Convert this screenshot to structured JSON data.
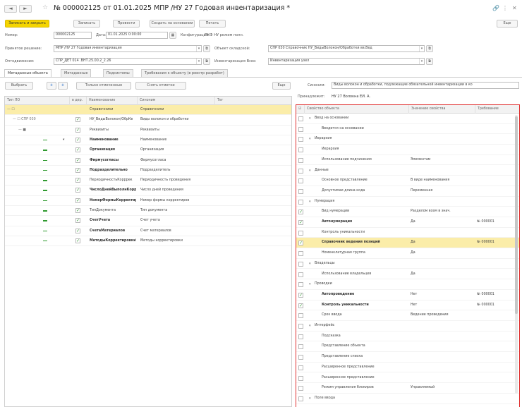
{
  "window": {
    "title": "№ 000002125 от 01.01.2025 МПР /НУ 27 Годовая инвентаризация *",
    "nav_back": "◄",
    "nav_fwd": "►",
    "more_label": "Еще"
  },
  "toolbar": {
    "post_close": "Записать и закрыть",
    "write": "Записать",
    "post": "Провести",
    "create_based": "Создать на основании",
    "print": "Печать"
  },
  "header": {
    "number_label": "Номер:",
    "number_value": "000002125",
    "date_label": "Дата:",
    "date_value": "01.01.2025 0:00:00",
    "config_label": "Конфигурация:",
    "config_value": "ПКФ НУ режим полн.",
    "basis_label": "Принятое решение:",
    "basis_value": "МПР /НУ 27 Годовая инвентаризация",
    "object_label": "Объект складской:",
    "object_value": "СПР 030 Справочник НУ_ВидыВолокон/Обработки вв.Вед",
    "org_label": "Оптодвижения:",
    "org_value": "СПР_ДЕТ 014 .ВНТ.25.00.2_2.26",
    "journal_label": "Инвентаризация Всех:",
    "journal_value": "Инвентаризация узел"
  },
  "tabs": [
    "Метаданные объекта",
    "Метаданные",
    "Подсистемы",
    "Требования к объекту (в реестр разработ)"
  ],
  "left": {
    "select_btn": "Выбрать",
    "add_btn": "+",
    "add2_btn": "+",
    "selected_btn": "Только отмеченные",
    "all_btn": "Снять отметки",
    "columns": [
      "Тип ЛО",
      "в дер.",
      "Наименование",
      "Синоним",
      "Тег"
    ],
    "rows": [
      {
        "tree": "— ☐",
        "mark": "",
        "name": "Справочники",
        "syn": "Справочники",
        "bold": false,
        "sel": true,
        "indent": 0
      },
      {
        "tree": "— ☐ СПР 030",
        "mark": "✓",
        "name": "НУ_ВидыВолокон/ОбрКв",
        "syn": "Виды волокон и обработки",
        "bold": false,
        "sel": false,
        "indent": 1
      },
      {
        "tree": "— ■",
        "mark": "✓",
        "name": "Реквизиты",
        "syn": "Реквизиты",
        "bold": false,
        "sel": false,
        "indent": 2
      },
      {
        "tree": "",
        "mark": "✓",
        "name": "Наименование",
        "syn": "Наименование",
        "bold": true,
        "sel": false,
        "indent": 3
      },
      {
        "tree": "",
        "mark": "✓",
        "name": "Организация",
        "syn": "Организация",
        "bold": true,
        "sel": false,
        "indent": 3
      },
      {
        "tree": "",
        "mark": "✓",
        "name": "Фирмусогласы",
        "syn": "Фирмусогласа",
        "bold": true,
        "sel": false,
        "indent": 3
      },
      {
        "tree": "",
        "mark": "✓",
        "name": "Подразделительно",
        "syn": "Подразделитель",
        "bold": true,
        "sel": false,
        "indent": 3
      },
      {
        "tree": "",
        "mark": "✓",
        "name": "ПериодичностьКорррек",
        "syn": "Периодичность проведения",
        "bold": false,
        "sel": false,
        "indent": 3
      },
      {
        "tree": "",
        "mark": "✓",
        "name": "ЧислоДнейВыполнКорр",
        "syn": "Число дней проведения",
        "bold": true,
        "sel": false,
        "indent": 3
      },
      {
        "tree": "",
        "mark": "✓",
        "name": "НомерФормыКорректиров",
        "syn": "Номер формы корректиров",
        "bold": true,
        "sel": false,
        "indent": 3
      },
      {
        "tree": "",
        "mark": "✓",
        "name": "ТипДокумента",
        "syn": "Тип документа",
        "bold": false,
        "sel": false,
        "indent": 3
      },
      {
        "tree": "",
        "mark": "✓",
        "name": "СчетУчета",
        "syn": "Счет учета",
        "bold": true,
        "sel": false,
        "indent": 3
      },
      {
        "tree": "",
        "mark": "✓",
        "name": "СчетаМатериалов",
        "syn": "Счет материалов",
        "bold": true,
        "sel": false,
        "indent": 3
      },
      {
        "tree": "",
        "mark": "✓",
        "name": "МетодыКорректировкиУч",
        "syn": "Методы корректировки",
        "bold": true,
        "sel": false,
        "indent": 3
      }
    ]
  },
  "right": {
    "synonym_label": "Синоним:",
    "synonym_value": "Виды волокон и обработки, подлежащие обязательной инвентаризации в ко",
    "owner_label": "Принадлежит:",
    "owner_value": "НУ 27 Волокна ЕИ. А.",
    "columns": [
      "Свойство объекта",
      "Значение свойства",
      "Требование"
    ],
    "rows": [
      {
        "tw": "▾",
        "lvl": 0,
        "chk": "",
        "prop": "Ввод на основании",
        "val": "",
        "req": "",
        "bold": false,
        "sel": false
      },
      {
        "tw": "",
        "lvl": 1,
        "chk": "",
        "prop": "Вводится на основании",
        "val": "",
        "req": "",
        "bold": false,
        "sel": false
      },
      {
        "tw": "▾",
        "lvl": 0,
        "chk": "",
        "prop": "Иерархия",
        "val": "",
        "req": "",
        "bold": false,
        "sel": false
      },
      {
        "tw": "",
        "lvl": 1,
        "chk": "",
        "prop": "Иерархия",
        "val": "",
        "req": "",
        "bold": false,
        "sel": false
      },
      {
        "tw": "",
        "lvl": 1,
        "chk": "",
        "prop": "Использование подчинения",
        "val": "Элементам",
        "req": "",
        "bold": false,
        "sel": false
      },
      {
        "tw": "▾",
        "lvl": 0,
        "chk": "",
        "prop": "Данные",
        "val": "",
        "req": "",
        "bold": false,
        "sel": false
      },
      {
        "tw": "",
        "lvl": 1,
        "chk": "",
        "prop": "Основное представление",
        "val": "В виде наименования",
        "req": "",
        "bold": false,
        "sel": false
      },
      {
        "tw": "",
        "lvl": 1,
        "chk": "",
        "prop": "Допустимая длина кода",
        "val": "Переменная",
        "req": "",
        "bold": false,
        "sel": false
      },
      {
        "tw": "▾",
        "lvl": 0,
        "chk": "",
        "prop": "Нумерация",
        "val": "",
        "req": "",
        "bold": false,
        "sel": false
      },
      {
        "tw": "",
        "lvl": 1,
        "chk": "✓",
        "prop": "Вид нумерации",
        "val": "Разделом всем в знач.",
        "req": "",
        "bold": false,
        "sel": false
      },
      {
        "tw": "",
        "lvl": 1,
        "chk": "✓",
        "prop": "Автонумерация",
        "val": "Да",
        "req": "№ 000001",
        "bold": true,
        "sel": false
      },
      {
        "tw": "",
        "lvl": 1,
        "chk": "",
        "prop": "Контроль уникальности",
        "val": "",
        "req": "",
        "bold": false,
        "sel": false
      },
      {
        "tw": "",
        "lvl": 1,
        "chk": "✓",
        "prop": "Справочник ведения позиций",
        "val": "Да",
        "req": "№ 000001",
        "bold": true,
        "sel": true
      },
      {
        "tw": "",
        "lvl": 1,
        "chk": "",
        "prop": "Номенклатурная группа",
        "val": "Да",
        "req": "",
        "bold": false,
        "sel": false
      },
      {
        "tw": "▾",
        "lvl": 0,
        "chk": "",
        "prop": "Владельцы",
        "val": "",
        "req": "",
        "bold": false,
        "sel": false
      },
      {
        "tw": "",
        "lvl": 1,
        "chk": "",
        "prop": "Использование владельцев",
        "val": "Да",
        "req": "",
        "bold": false,
        "sel": false
      },
      {
        "tw": "▾",
        "lvl": 0,
        "chk": "",
        "prop": "Проводки",
        "val": "",
        "req": "",
        "bold": false,
        "sel": false
      },
      {
        "tw": "",
        "lvl": 1,
        "chk": "✓",
        "prop": "Автопроведение",
        "val": "Нет",
        "req": "№ 000001",
        "bold": true,
        "sel": false
      },
      {
        "tw": "",
        "lvl": 1,
        "chk": "✓",
        "prop": "Контроль уникальности",
        "val": "Нет",
        "req": "№ 000001",
        "bold": true,
        "sel": false
      },
      {
        "tw": "",
        "lvl": 1,
        "chk": "",
        "prop": "Срок ввода",
        "val": "Ведение проведения",
        "req": "",
        "bold": false,
        "sel": false
      },
      {
        "tw": "▾",
        "lvl": 0,
        "chk": "",
        "prop": "Интерфейс",
        "val": "",
        "req": "",
        "bold": false,
        "sel": false
      },
      {
        "tw": "",
        "lvl": 1,
        "chk": "",
        "prop": "Подсказка",
        "val": "",
        "req": "",
        "bold": false,
        "sel": false
      },
      {
        "tw": "",
        "lvl": 1,
        "chk": "",
        "prop": "Представление объекта",
        "val": "",
        "req": "",
        "bold": false,
        "sel": false
      },
      {
        "tw": "",
        "lvl": 1,
        "chk": "",
        "prop": "Представление списка",
        "val": "",
        "req": "",
        "bold": false,
        "sel": false
      },
      {
        "tw": "",
        "lvl": 1,
        "chk": "",
        "prop": "Расширенное представление",
        "val": "",
        "req": "",
        "bold": false,
        "sel": false
      },
      {
        "tw": "",
        "lvl": 1,
        "chk": "",
        "prop": "Расширенное представление",
        "val": "",
        "req": "",
        "bold": false,
        "sel": false
      },
      {
        "tw": "",
        "lvl": 1,
        "chk": "",
        "prop": "Режим управления блокиров",
        "val": "Управляемый",
        "req": "",
        "bold": false,
        "sel": false
      },
      {
        "tw": "▾",
        "lvl": 0,
        "chk": "",
        "prop": "Поле ввода",
        "val": "",
        "req": "",
        "bold": false,
        "sel": false
      }
    ]
  },
  "colors": {
    "accent": "#f5d500",
    "selection": "#fbeda9",
    "check_green": "#2f9a2f",
    "highlight_border": "#e03030"
  }
}
